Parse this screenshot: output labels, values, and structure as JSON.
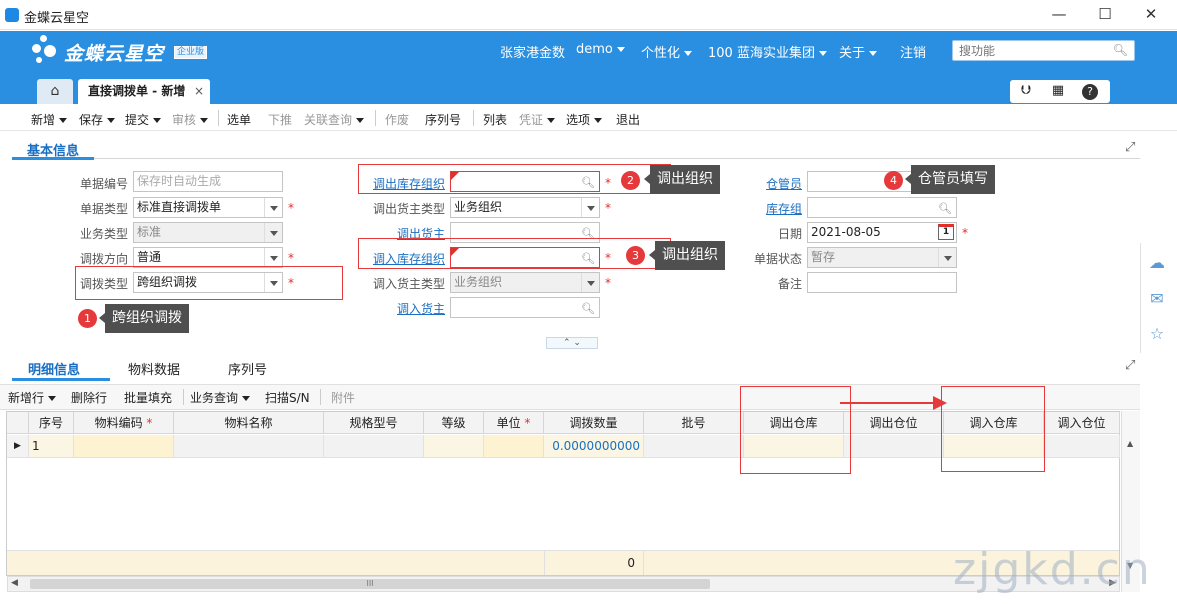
{
  "window": {
    "title": "金蝶云星空",
    "minimize": "—",
    "maximize": "☐",
    "close": "✕"
  },
  "header": {
    "logo_text": "金蝶云星空",
    "edition": "企业版",
    "nav": [
      "张家港金数",
      "demo",
      "个性化",
      "100 蓝海实业集团",
      "关于",
      "注销"
    ],
    "search_placeholder": "搜功能"
  },
  "tabs": {
    "home_icon": "home-icon",
    "doc_tab": "直接调拨单 - 新增",
    "close": "×"
  },
  "toolbar": {
    "items": [
      {
        "label": "新增",
        "dropdown": true,
        "enabled": true
      },
      {
        "label": "保存",
        "dropdown": true,
        "enabled": true
      },
      {
        "label": "提交",
        "dropdown": true,
        "enabled": true
      },
      {
        "label": "审核",
        "dropdown": true,
        "enabled": false
      },
      {
        "label": "选单",
        "dropdown": false,
        "enabled": true
      },
      {
        "label": "下推",
        "dropdown": false,
        "enabled": false
      },
      {
        "label": "关联查询",
        "dropdown": true,
        "enabled": false
      },
      {
        "label": "作废",
        "dropdown": false,
        "enabled": false
      },
      {
        "label": "序列号",
        "dropdown": false,
        "enabled": true
      },
      {
        "label": "列表",
        "dropdown": false,
        "enabled": true
      },
      {
        "label": "凭证",
        "dropdown": true,
        "enabled": false
      },
      {
        "label": "选项",
        "dropdown": true,
        "enabled": true
      },
      {
        "label": "退出",
        "dropdown": false,
        "enabled": true
      }
    ]
  },
  "basic_info": {
    "title": "基本信息",
    "doc_no": {
      "label": "单据编号",
      "placeholder": "保存时自动生成"
    },
    "doc_type": {
      "label": "单据类型",
      "value": "标准直接调拨单"
    },
    "biz_type": {
      "label": "业务类型",
      "value": "标准"
    },
    "transfer_dir": {
      "label": "调拨方向",
      "value": "普通"
    },
    "transfer_type": {
      "label": "调拨类型",
      "value": "跨组织调拨"
    },
    "out_org": {
      "label": "调出库存组织",
      "value": ""
    },
    "out_owner_type": {
      "label": "调出货主类型",
      "value": "业务组织"
    },
    "out_owner": {
      "label": "调出货主",
      "value": ""
    },
    "in_org": {
      "label": "调入库存组织",
      "value": ""
    },
    "in_owner_type": {
      "label": "调入货主类型",
      "value": "业务组织"
    },
    "in_owner": {
      "label": "调入货主",
      "value": ""
    },
    "keeper": {
      "label": "仓管员",
      "value": ""
    },
    "stock_group": {
      "label": "库存组",
      "value": ""
    },
    "date": {
      "label": "日期",
      "value": "2021-08-05",
      "cal_day": "1"
    },
    "status": {
      "label": "单据状态",
      "value": "暂存"
    },
    "remark": {
      "label": "备注",
      "value": ""
    },
    "required_mark": "*"
  },
  "annotations": [
    {
      "num": "1",
      "text": "跨组织调拨"
    },
    {
      "num": "2",
      "text": "调出组织"
    },
    {
      "num": "3",
      "text": "调出组织"
    },
    {
      "num": "4",
      "text": "仓管员填写"
    }
  ],
  "collapse": "⌃ ⌄",
  "detail_tabs": [
    "明细信息",
    "物料数据",
    "序列号"
  ],
  "grid_toolbar": [
    {
      "label": "新增行",
      "dropdown": true,
      "enabled": true
    },
    {
      "label": "删除行",
      "dropdown": false,
      "enabled": true
    },
    {
      "label": "批量填充",
      "dropdown": false,
      "enabled": true
    },
    {
      "label": "业务查询",
      "dropdown": true,
      "enabled": true
    },
    {
      "label": "扫描S/N",
      "dropdown": false,
      "enabled": true
    },
    {
      "label": "附件",
      "dropdown": false,
      "enabled": false
    }
  ],
  "grid": {
    "columns": [
      "序号",
      "物料编码",
      "物料名称",
      "规格型号",
      "等级",
      "单位",
      "调拨数量",
      "批号",
      "调出仓库",
      "调出仓位",
      "调入仓库",
      "调入仓位"
    ],
    "required_cols": [
      "物料编码",
      "单位"
    ],
    "row": {
      "seq": "1",
      "qty": "0.0000000000"
    },
    "footer_qty": "0",
    "scroll_thumb": "III"
  },
  "watermark": "zjgkd.cn",
  "colors": {
    "header": "#2a8fe0",
    "annotation_red": "#e5393b",
    "link": "#1a6fc2"
  }
}
